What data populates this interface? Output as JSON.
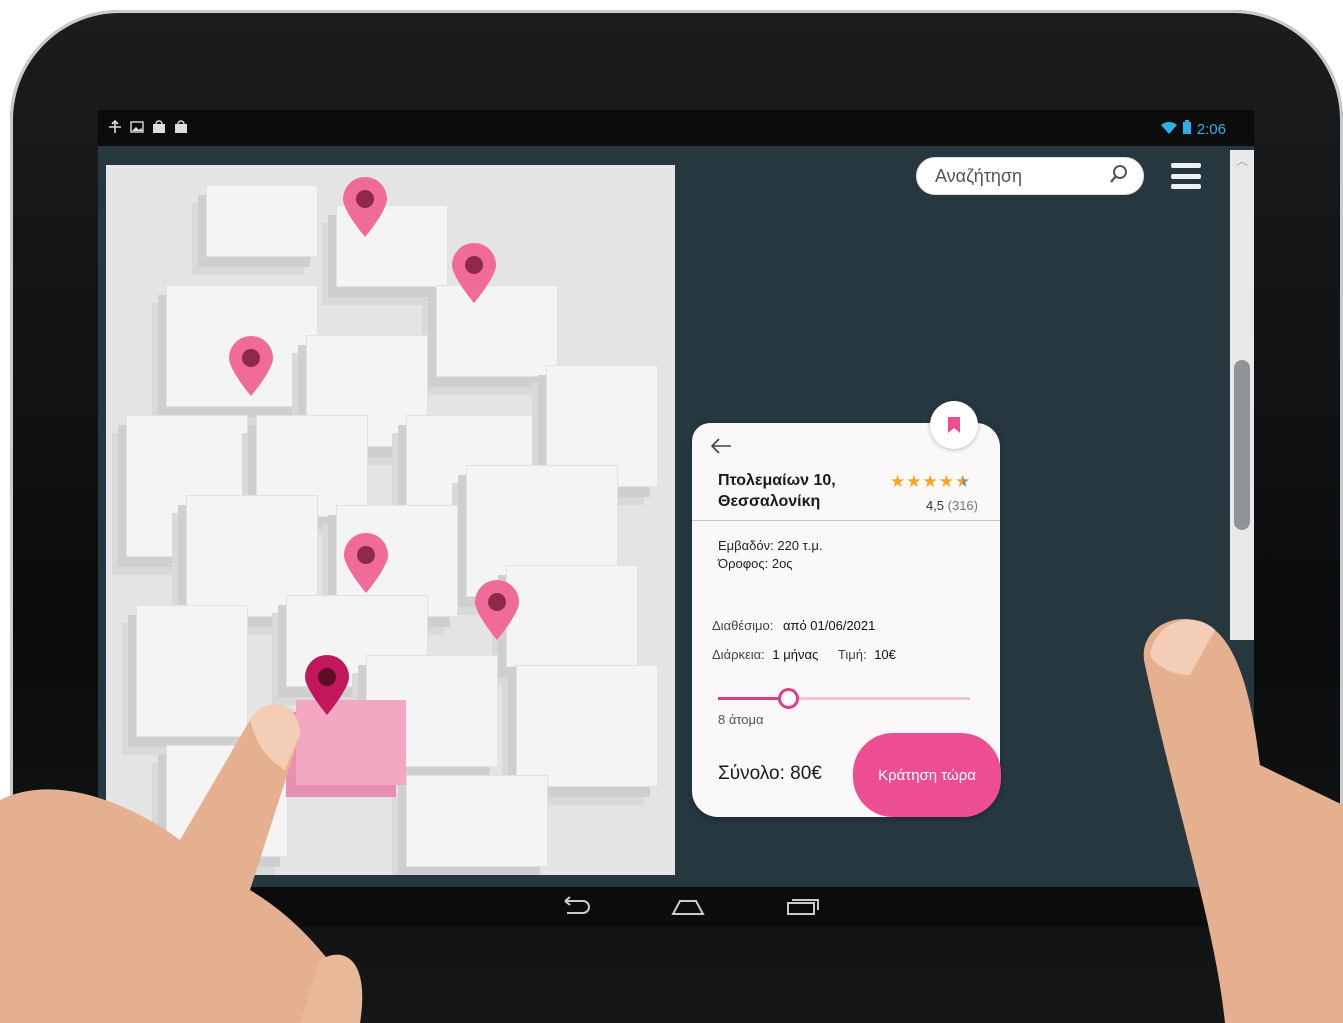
{
  "statusbar": {
    "left_icons": [
      "usb-debug-icon",
      "image-icon",
      "store-icon",
      "store-icon"
    ],
    "time": "2:06",
    "wifi": "wifi-icon",
    "battery": "battery-icon"
  },
  "search": {
    "placeholder": "Αναζήτηση"
  },
  "map": {
    "pins": 6,
    "selected_pin_color": "#c2185b",
    "pin_color": "#f06a9a"
  },
  "listing": {
    "title_line1": "Πτολεμαίων 10,",
    "title_line2": "Θεσσαλονίκη",
    "rating_value": 4.5,
    "rating_text": "4,5",
    "rating_count": "(316)",
    "area": "Εμβαδόν: 220 τ.μ.",
    "floor": "Όροφος: 2ος",
    "available_label": "Διαθέσιμο:",
    "available_value": "από  01/06/2021",
    "duration_label": "Διάρκεια:",
    "duration_value": "1 μήνας",
    "price_label": "Τιμή:",
    "price_value": "10€",
    "people_slider_value": 0.28,
    "people": "8 άτομα",
    "total": "Σύνολο: 80€",
    "book_button": "Κράτηση τώρα"
  },
  "colors": {
    "accent": "#ec4d93",
    "background": "#263740",
    "star": "#f5a623"
  }
}
